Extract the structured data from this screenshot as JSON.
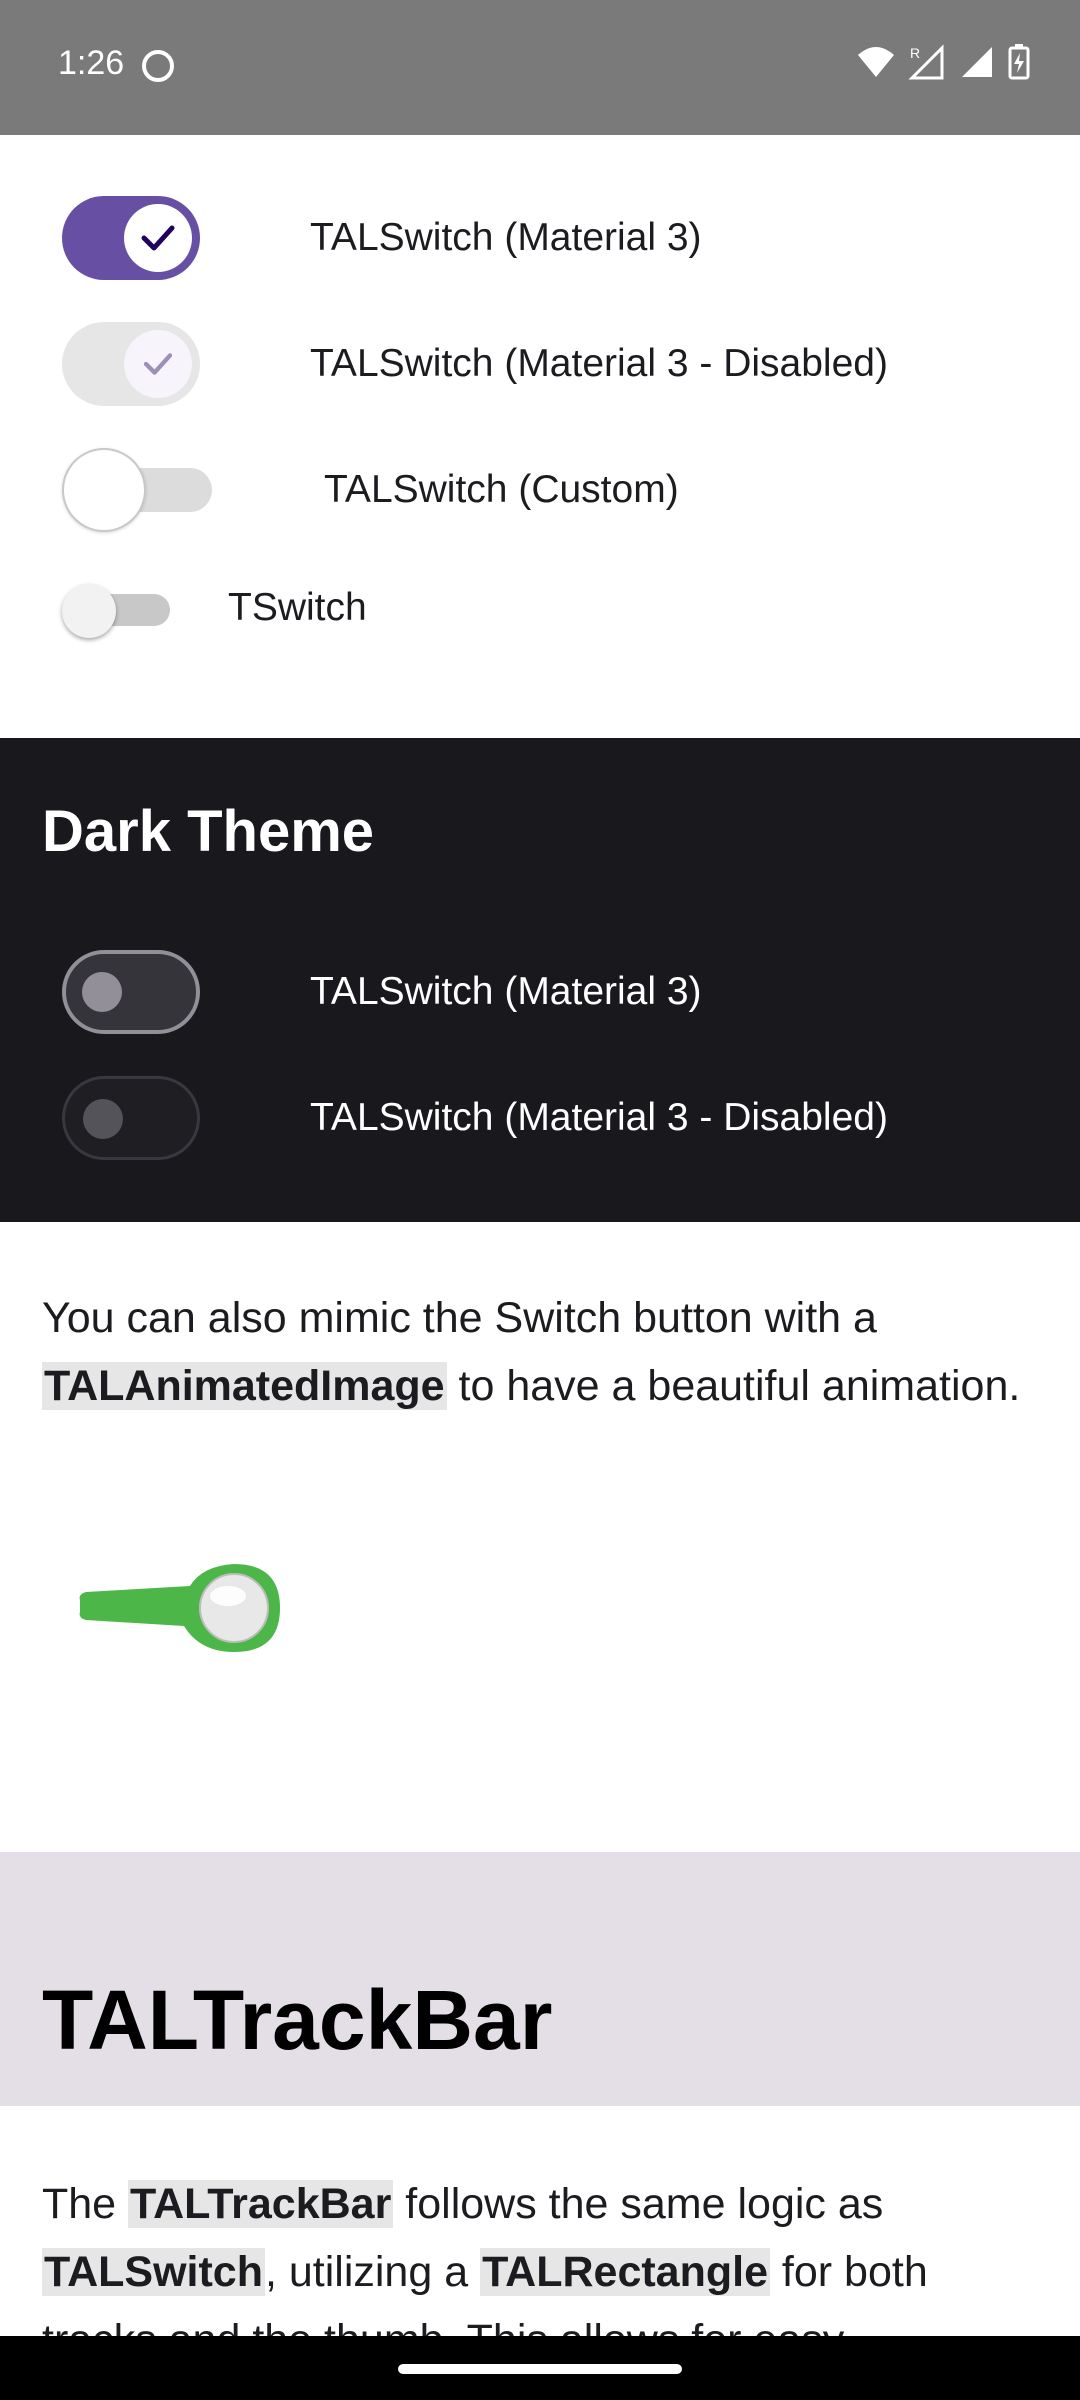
{
  "status_bar": {
    "time": "1:26",
    "icons": [
      "wifi-icon",
      "signal-r-icon",
      "signal-icon",
      "battery-charging-icon"
    ]
  },
  "light_switches": [
    {
      "label": "TALSwitch (Material 3)"
    },
    {
      "label": "TALSwitch (Material 3 - Disabled)"
    },
    {
      "label": "TALSwitch (Custom)"
    },
    {
      "label": "TSwitch"
    }
  ],
  "dark_section": {
    "title": "Dark Theme",
    "switches": [
      {
        "label": "TALSwitch (Material 3)"
      },
      {
        "label": "TALSwitch (Material 3 - Disabled)"
      }
    ]
  },
  "mimic_paragraph": {
    "part1": "You can also mimic the Switch button with a ",
    "code1": "TALAnimatedImage",
    "part2": " to have a beautiful animation."
  },
  "trackbar": {
    "title": "TALTrackBar",
    "p_pre": "The ",
    "code1": "TALTrackBar",
    "p_mid1": " follows the same logic as ",
    "code2": "TALSwitch",
    "p_mid2": ", utilizing a ",
    "code3": "TALRectangle",
    "p_end": " for both tracks and the thumb. This allows for easy"
  },
  "colors": {
    "accent": "#6750a4",
    "dark_bg": "#19181d",
    "green_switch": "#4cb648"
  }
}
